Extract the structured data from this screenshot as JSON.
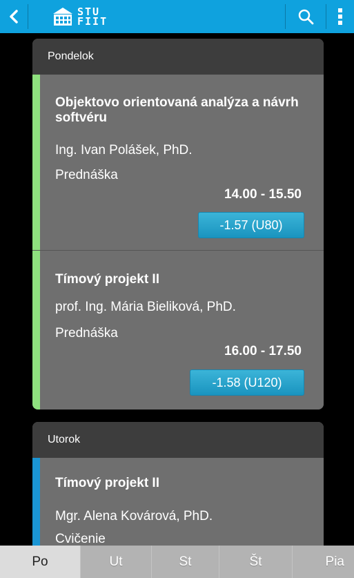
{
  "app": {
    "logo_line1": "STU",
    "logo_line2": "FIIT"
  },
  "days": [
    {
      "name": "Pondelok",
      "lessons": [
        {
          "title": "Objektovo orientovaná analýza a návrh softvéru",
          "teacher": "Ing. Ivan Polášek, PhD.",
          "type": "Prednáška",
          "time": "14.00 - 15.50",
          "room": "-1.57 (U80)",
          "stripe_color": "#8ee07e"
        },
        {
          "title": "Tímový projekt II",
          "teacher": "prof. Ing. Mária Bieliková, PhD.",
          "type": "Prednáška",
          "time": "16.00 - 17.50",
          "room": "-1.58 (U120)",
          "stripe_color": "#8ee07e"
        }
      ]
    },
    {
      "name": "Utorok",
      "lessons": [
        {
          "title": "Tímový projekt II",
          "teacher": "Mgr. Alena Kovárová, PhD.",
          "type": "Cvičenie",
          "stripe_color": "#1a95d4"
        }
      ]
    }
  ],
  "tabs": [
    {
      "label": "Po",
      "active": true
    },
    {
      "label": "Ut",
      "active": false
    },
    {
      "label": "St",
      "active": false
    },
    {
      "label": "Št",
      "active": false
    },
    {
      "label": "Pia",
      "active": false
    }
  ],
  "colors": {
    "topbar": "#0fa2de",
    "room_button": "#1a94bf"
  }
}
